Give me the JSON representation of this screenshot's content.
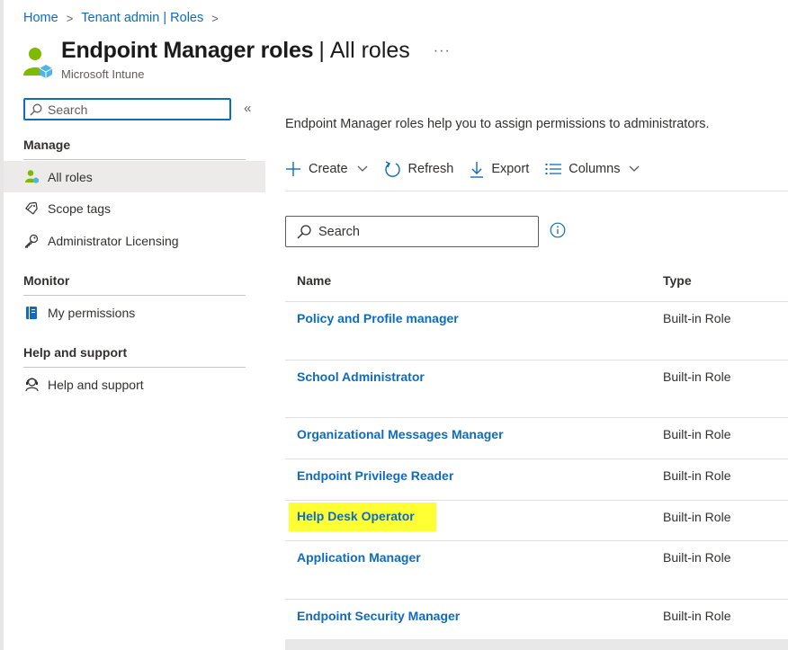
{
  "breadcrumb": {
    "home": "Home",
    "section": "Tenant admin | Roles",
    "sep": ">"
  },
  "header": {
    "title": "Endpoint Manager roles",
    "title_sep": "|",
    "subtitle": "All roles",
    "more": "···",
    "service": "Microsoft Intune"
  },
  "nav": {
    "search_placeholder": "Search",
    "collapse": "«",
    "sections": {
      "manage": "Manage",
      "monitor": "Monitor",
      "help": "Help and support"
    },
    "items": [
      {
        "label": "All roles",
        "icon": "roles-icon",
        "active": true
      },
      {
        "label": "Scope tags",
        "icon": "tag-icon"
      },
      {
        "label": "Administrator Licensing",
        "icon": "key-icon"
      },
      {
        "label": "My permissions",
        "icon": "notebook-icon"
      },
      {
        "label": "Help and support",
        "icon": "support-icon"
      }
    ]
  },
  "main": {
    "description": "Endpoint Manager roles help you to assign permissions to administrators.",
    "toolbar": {
      "create": "Create",
      "refresh": "Refresh",
      "export": "Export",
      "columns": "Columns"
    },
    "search_placeholder": "Search",
    "table": {
      "columns": [
        "Name",
        "Type"
      ],
      "rows": [
        {
          "name": "Policy and Profile manager",
          "type": "Built-in Role"
        },
        {
          "name": "School Administrator",
          "type": "Built-in Role"
        },
        {
          "name": "Organizational Messages Manager",
          "type": "Built-in Role"
        },
        {
          "name": "Endpoint Privilege Reader",
          "type": "Built-in Role"
        },
        {
          "name": "Help Desk Operator",
          "type": "Built-in Role",
          "highlighted": true
        },
        {
          "name": "Application Manager",
          "type": "Built-in Role"
        },
        {
          "name": "Endpoint Security Manager",
          "type": "Built-in Role"
        }
      ]
    }
  },
  "colors": {
    "link": "#0f6cbd",
    "highlight": "#ffff33",
    "active_nav": "#edebe9"
  }
}
